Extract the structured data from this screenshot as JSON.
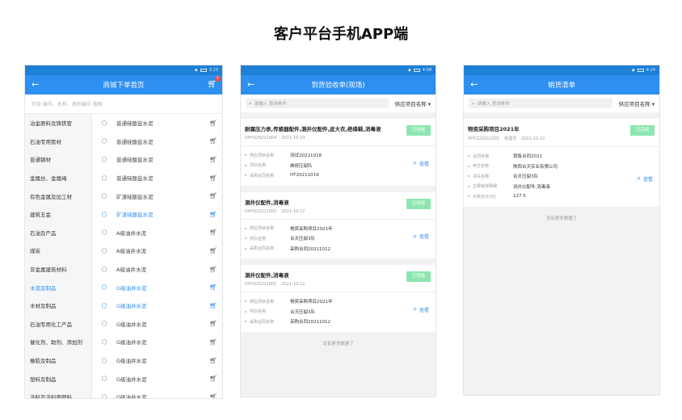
{
  "page_title": "客户平台手机APP端",
  "colors": {
    "primary": "#2d8ff0",
    "status_green": "#8de6b0",
    "badge_red": "#f04545"
  },
  "phone1": {
    "statusbar": {
      "left": "",
      "right": "3:15"
    },
    "title": "商城下单首页",
    "cart_count": "1",
    "search_placeholder": "可按 编号、名称、类别编号 搜索",
    "categories": [
      {
        "label": "冶金原料及铸铁管",
        "active": false
      },
      {
        "label": "石油专用管材",
        "active": false
      },
      {
        "label": "普通钢材",
        "active": false
      },
      {
        "label": "金属丝、金属绳",
        "active": false
      },
      {
        "label": "有色金属及加工材",
        "active": false
      },
      {
        "label": "建筑五金",
        "active": false
      },
      {
        "label": "石油及产品",
        "active": false
      },
      {
        "label": "煤炭",
        "active": false
      },
      {
        "label": "非金属建筑材料",
        "active": false
      },
      {
        "label": "水泥及制品",
        "active": true
      },
      {
        "label": "木材及制品",
        "active": false
      },
      {
        "label": "石油专用化工产品",
        "active": false
      },
      {
        "label": "催化剂、助剂、添加剂",
        "active": false
      },
      {
        "label": "橡胶及制品",
        "active": false
      },
      {
        "label": "塑料及制品",
        "active": false
      },
      {
        "label": "涂料及涂料用颜料",
        "active": false
      }
    ],
    "products": [
      {
        "label": "普通硅酸盐水泥",
        "active": false
      },
      {
        "label": "普通硅酸盐水泥",
        "active": false
      },
      {
        "label": "普通硅酸盐水泥",
        "active": false
      },
      {
        "label": "普通硅酸盐水泥",
        "active": false
      },
      {
        "label": "矿渣硅酸盐水泥",
        "active": false
      },
      {
        "label": "矿渣硅酸盐水泥",
        "active": true
      },
      {
        "label": "A级油井水泥",
        "active": false
      },
      {
        "label": "A级油井水泥",
        "active": false
      },
      {
        "label": "A级油井水泥",
        "active": false
      },
      {
        "label": "G级油井水泥",
        "active": true
      },
      {
        "label": "G级油井水泥",
        "active": true
      },
      {
        "label": "G级油井水泥",
        "active": false
      },
      {
        "label": "G级油井水泥",
        "active": false
      },
      {
        "label": "G级油井水泥",
        "active": false
      },
      {
        "label": "G级油井水泥",
        "active": false
      },
      {
        "label": "G级油井水泥",
        "active": false
      }
    ]
  },
  "phone2": {
    "statusbar": {
      "left": "",
      "right": "4:08"
    },
    "title": "到货验收单(现场)",
    "search_placeholder": "请输入 查询条件",
    "select_label": "供应项目名称",
    "cards": [
      {
        "title": "耐腐压力表,传感器配件,测井仪配件,皮大衣,绝缘鞋,消毒液",
        "code": "DHYS20211004",
        "date": "2021-10-19",
        "status": "已验收",
        "fields": [
          {
            "label": "供应项目名称",
            "value": "测试20211018"
          },
          {
            "label": "井队名称",
            "value": "维修压裂队"
          },
          {
            "label": "采购合同名称",
            "value": "HT20211019"
          }
        ],
        "view": "查看"
      },
      {
        "title": "测井仪配件,消毒液",
        "code": "DHYS20211002",
        "date": "2021-10-12",
        "status": "已验收",
        "fields": [
          {
            "label": "供应项目名称",
            "value": "物资采购项目2021年"
          },
          {
            "label": "井队名称",
            "value": "合天压裂3队"
          },
          {
            "label": "采购合同名称",
            "value": "采购合同20211012"
          }
        ],
        "view": "查看"
      },
      {
        "title": "测井仪配件,消毒液",
        "code": "DHYS20211001",
        "date": "2021-10-12",
        "status": "已验收",
        "fields": [
          {
            "label": "供应项目名称",
            "value": "物资采购项目2021年"
          },
          {
            "label": "井队名称",
            "value": "合天压裂3队"
          },
          {
            "label": "采购合同名称",
            "value": "采购合同20211012"
          }
        ],
        "view": "查看"
      }
    ],
    "no_more": "没有更多数据了"
  },
  "phone3": {
    "statusbar": {
      "left": "",
      "right": "4:24"
    },
    "title": "销货清单",
    "search_placeholder": "请输入 查询条件",
    "select_label": "供应项目名称",
    "card": {
      "title": "物资采购项目2021年",
      "code": "XHTZ20211001",
      "person": "管理员",
      "date": "2021-10-13",
      "status": "已完成",
      "fields": [
        {
          "label": "合同名称",
          "value": "销售合同2021"
        },
        {
          "label": "甲方名称",
          "value": "陕西合天实业有限公司"
        },
        {
          "label": "井队名称",
          "value": "合天压裂3队"
        },
        {
          "label": "主要销货明细",
          "value": "测井仪配件,消毒液"
        },
        {
          "label": "价税合计(元)",
          "value": "127.5"
        }
      ],
      "view": "查看"
    },
    "no_more": "没有更多数据了"
  }
}
